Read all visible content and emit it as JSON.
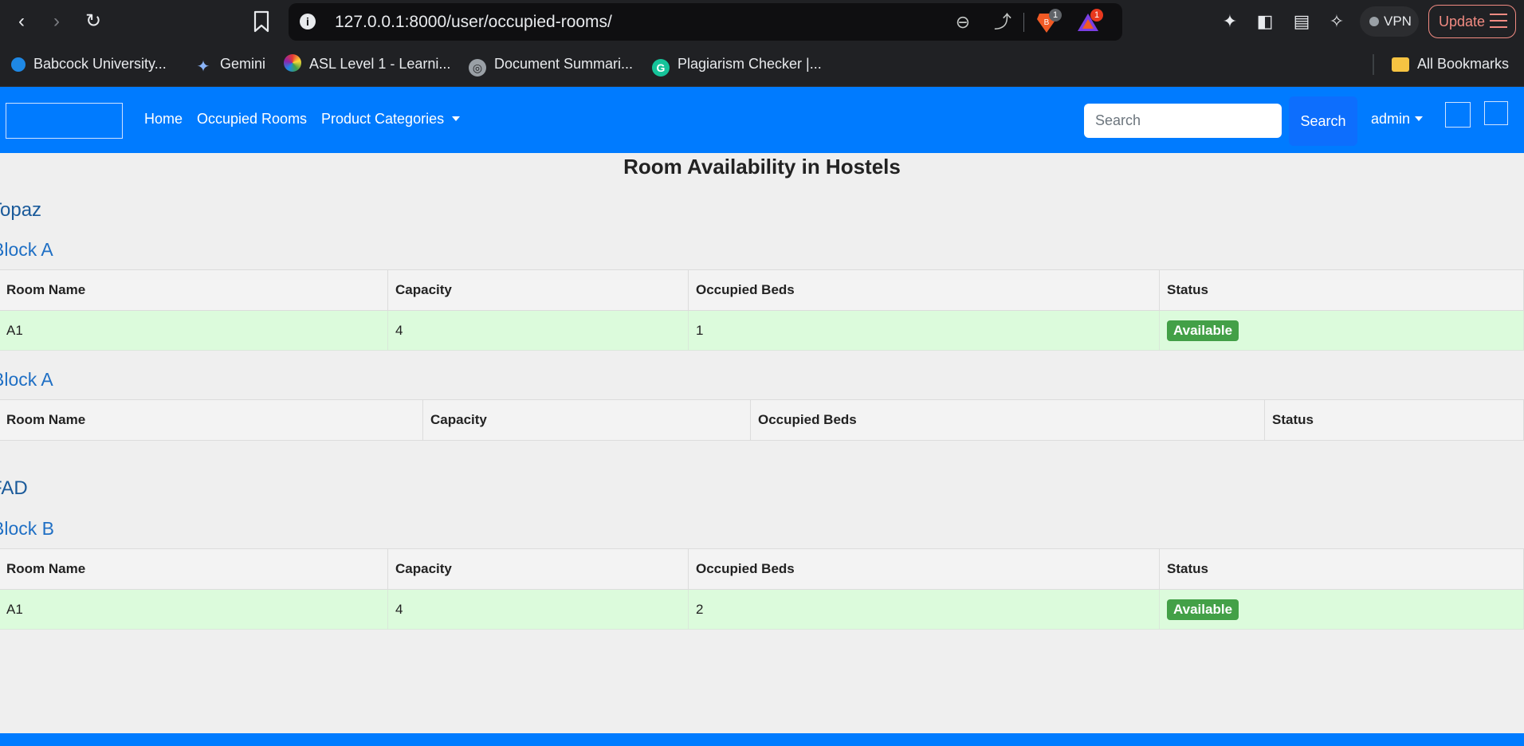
{
  "browser": {
    "url": "127.0.0.1:8000/user/occupied-rooms/",
    "brave_badge": "1",
    "rewards_badge": "1",
    "vpn_label": "VPN",
    "update_label": "Update",
    "bookmarks": [
      {
        "label": "Babcock University...",
        "icon": "babcock-icon"
      },
      {
        "label": "Gemini",
        "icon": "gemini-icon"
      },
      {
        "label": "ASL Level 1 - Learni...",
        "icon": "asl-icon"
      },
      {
        "label": "Document Summari...",
        "icon": "globe-icon"
      },
      {
        "label": "Plagiarism Checker |...",
        "icon": "grammarly-icon"
      }
    ],
    "all_bookmarks_label": "All Bookmarks"
  },
  "navbar": {
    "links": {
      "home": "Home",
      "occupied_rooms": "Occupied Rooms",
      "product_categories": "Product Categories"
    },
    "search_placeholder": "Search",
    "search_button": "Search",
    "user": "admin"
  },
  "page": {
    "title": "Room Availability in Hostels",
    "columns": [
      "Room Name",
      "Capacity",
      "Occupied Beds",
      "Status"
    ],
    "hostels": [
      {
        "name": "Topaz",
        "blocks": [
          {
            "name": "Block A",
            "rows": [
              {
                "room": "A1",
                "capacity": "4",
                "occupied": "1",
                "status": "Available"
              }
            ]
          },
          {
            "name": "Block A",
            "rows": []
          }
        ]
      },
      {
        "name": "FAD",
        "blocks": [
          {
            "name": "Block B",
            "rows": [
              {
                "room": "A1",
                "capacity": "4",
                "occupied": "2",
                "status": "Available"
              }
            ]
          }
        ]
      }
    ]
  },
  "colors": {
    "navbar": "#007bff",
    "available_badge": "#43a047",
    "row_available": "#dcfbdc"
  }
}
